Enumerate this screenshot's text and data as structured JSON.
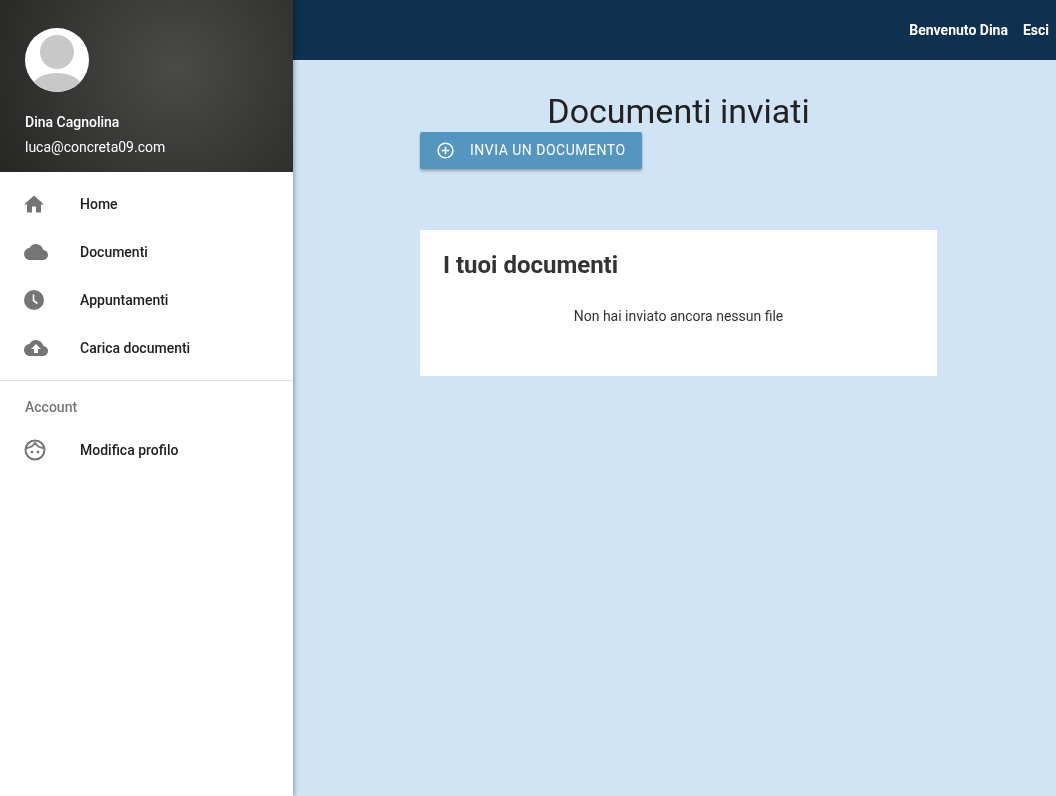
{
  "sidebar": {
    "user": {
      "name": "Dina Cagnolina",
      "email": "luca@concreta09.com"
    },
    "items": [
      {
        "kind": "home",
        "label": "Home"
      },
      {
        "kind": "cloud",
        "label": "Documenti"
      },
      {
        "kind": "clock",
        "label": "Appuntamenti"
      },
      {
        "kind": "upload",
        "label": "Carica documenti"
      }
    ],
    "section": "Account",
    "account_items": [
      {
        "kind": "face",
        "label": "Modifica profilo"
      }
    ]
  },
  "topbar": {
    "greeting": "Benvenuto Dina",
    "logout": "Esci"
  },
  "page": {
    "title": "Documenti inviati",
    "button": "INVIA UN DOCUMENTO",
    "card": {
      "title": "I tuoi documenti",
      "empty": "Non hai inviato ancora nessun file"
    }
  }
}
